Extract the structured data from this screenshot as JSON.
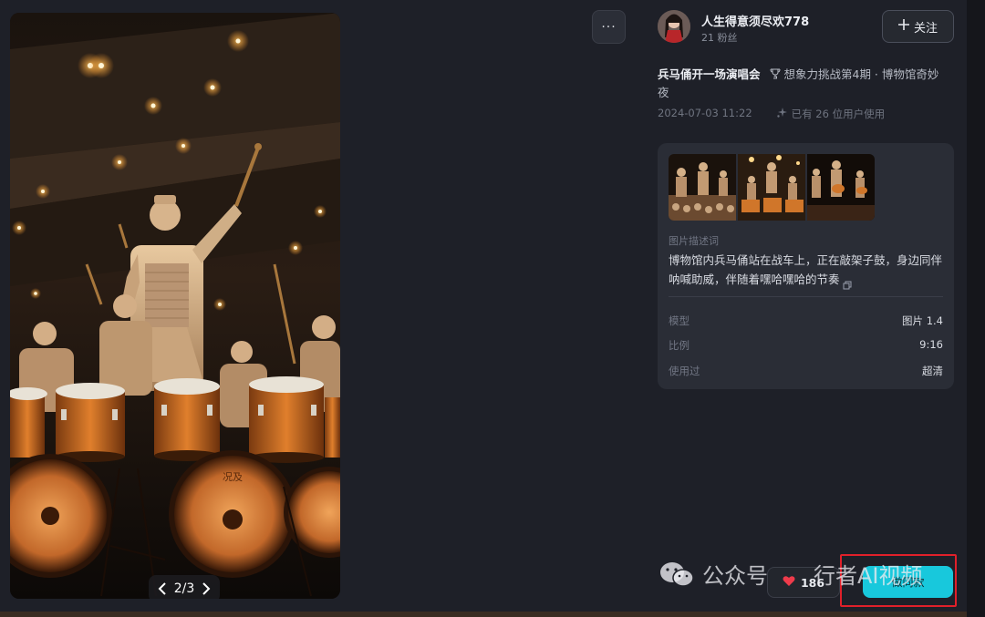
{
  "image_viewer": {
    "pager": {
      "current": "2/3"
    }
  },
  "author": {
    "name": "人生得意须尽欢778",
    "fans": "21 粉丝"
  },
  "follow": {
    "label": "关注"
  },
  "post": {
    "title": "兵马俑开一场演唱会",
    "challenge": "想象力挑战第4期 · 博物馆奇妙夜",
    "date": "2024-07-03 11:22",
    "usage": "已有 26 位用户使用"
  },
  "info": {
    "desc_label": "图片描述词",
    "desc_text": "博物馆内兵马俑站在战车上，正在敲架子鼓，身边同伴呐喊助威，伴随着嘿哈嘿哈的节奏",
    "rows": [
      {
        "key": "模型",
        "value": "图片 1.4"
      },
      {
        "key": "比例",
        "value": "9:16"
      },
      {
        "key": "使用过",
        "value": "超清"
      }
    ]
  },
  "actions": {
    "likes": "186",
    "same_label": "做同款"
  },
  "watermark": {
    "left": "公众号",
    "right": "行者AI视频"
  },
  "colors": {
    "accent": "#18c8dc",
    "highlight": "#e0202a",
    "heart": "#ef3b4b"
  }
}
